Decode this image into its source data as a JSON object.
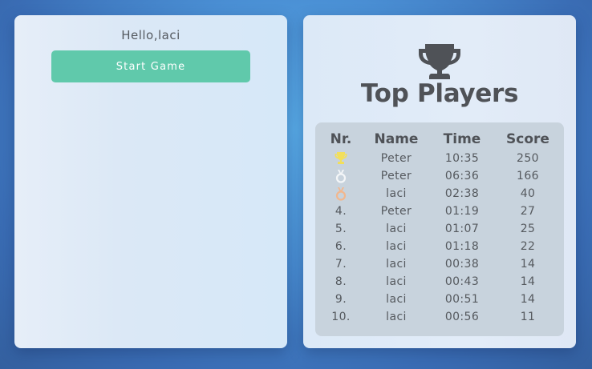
{
  "left_panel": {
    "greeting": "Hello,laci",
    "start_button_label": "Start Game"
  },
  "right_panel": {
    "icon": "trophy-icon",
    "title": "Top Players",
    "table": {
      "headers": [
        "Nr.",
        "Name",
        "Time",
        "Score"
      ],
      "rows": [
        {
          "rank": "",
          "rank_icon": "gold-trophy-icon",
          "name": "Peter",
          "time": "10:35",
          "score": "250"
        },
        {
          "rank": "",
          "rank_icon": "silver-medal-icon",
          "name": "Peter",
          "time": "06:36",
          "score": "166"
        },
        {
          "rank": "",
          "rank_icon": "bronze-medal-icon",
          "name": "laci",
          "time": "02:38",
          "score": "40"
        },
        {
          "rank": "4.",
          "name": "Peter",
          "time": "01:19",
          "score": "27"
        },
        {
          "rank": "5.",
          "name": "laci",
          "time": "01:07",
          "score": "25"
        },
        {
          "rank": "6.",
          "name": "laci",
          "time": "01:18",
          "score": "22"
        },
        {
          "rank": "7.",
          "name": "laci",
          "time": "00:38",
          "score": "14"
        },
        {
          "rank": "8.",
          "name": "laci",
          "time": "00:43",
          "score": "14"
        },
        {
          "rank": "9.",
          "name": "laci",
          "time": "00:51",
          "score": "14"
        },
        {
          "rank": "10.",
          "name": "laci",
          "time": "00:56",
          "score": "11"
        }
      ]
    }
  },
  "colors": {
    "accent": "#60c9ab",
    "gold": "#f2df5b",
    "silver": "#f4f6f8",
    "bronze": "#f2b78e",
    "text": "#55595e"
  }
}
